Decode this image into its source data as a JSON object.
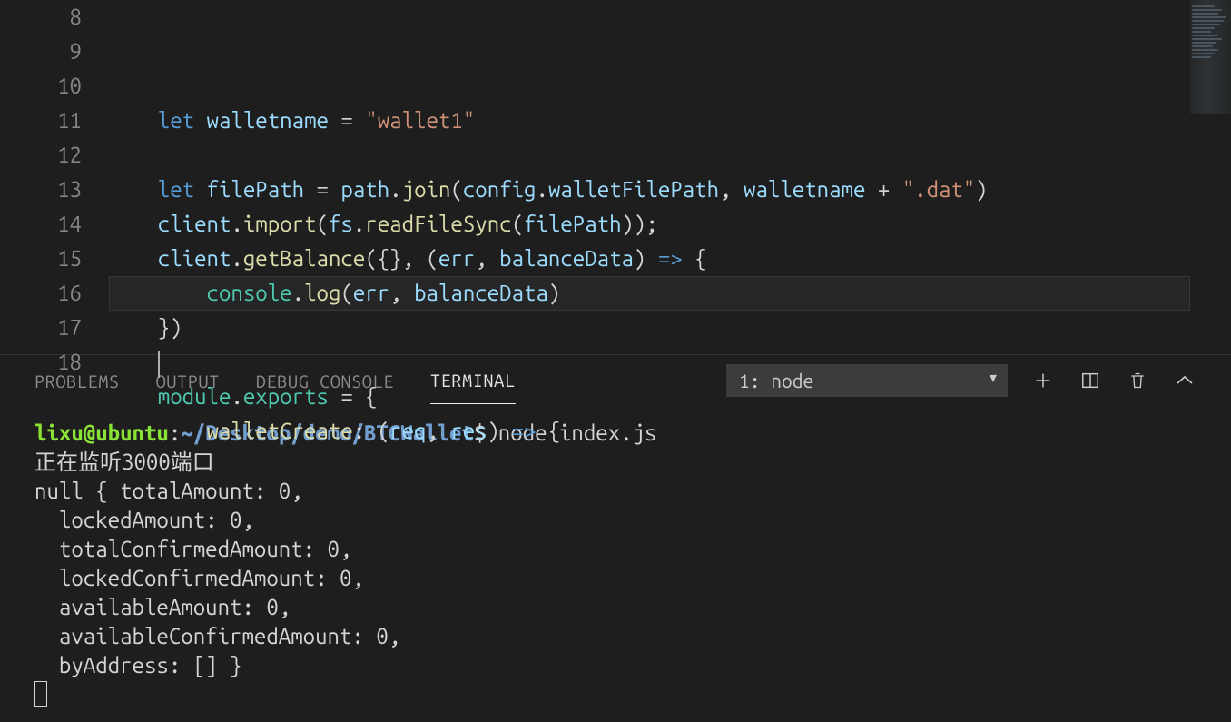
{
  "editor": {
    "line_numbers": [
      "8",
      "9",
      "10",
      "11",
      "12",
      "13",
      "14",
      "15",
      "16",
      "17",
      "18"
    ],
    "highlight_row_index": 8,
    "lines": [
      {
        "tokens": []
      },
      {
        "tokens": [
          {
            "t": "    ",
            "c": "punct"
          },
          {
            "t": "let",
            "c": "kw"
          },
          {
            "t": " ",
            "c": "punct"
          },
          {
            "t": "walletname",
            "c": "var"
          },
          {
            "t": " = ",
            "c": "punct"
          },
          {
            "t": "\"wallet1\"",
            "c": "str"
          }
        ]
      },
      {
        "tokens": []
      },
      {
        "tokens": [
          {
            "t": "    ",
            "c": "punct"
          },
          {
            "t": "let",
            "c": "kw"
          },
          {
            "t": " ",
            "c": "punct"
          },
          {
            "t": "filePath",
            "c": "var"
          },
          {
            "t": " = ",
            "c": "punct"
          },
          {
            "t": "path",
            "c": "var"
          },
          {
            "t": ".",
            "c": "punct"
          },
          {
            "t": "join",
            "c": "fn"
          },
          {
            "t": "(",
            "c": "punct"
          },
          {
            "t": "config",
            "c": "var"
          },
          {
            "t": ".",
            "c": "punct"
          },
          {
            "t": "walletFilePath",
            "c": "var"
          },
          {
            "t": ", ",
            "c": "punct"
          },
          {
            "t": "walletname",
            "c": "var"
          },
          {
            "t": " + ",
            "c": "punct"
          },
          {
            "t": "\".dat\"",
            "c": "str"
          },
          {
            "t": ")",
            "c": "punct"
          }
        ]
      },
      {
        "tokens": [
          {
            "t": "    ",
            "c": "punct"
          },
          {
            "t": "client",
            "c": "var"
          },
          {
            "t": ".",
            "c": "punct"
          },
          {
            "t": "import",
            "c": "fn"
          },
          {
            "t": "(",
            "c": "punct"
          },
          {
            "t": "fs",
            "c": "var"
          },
          {
            "t": ".",
            "c": "punct"
          },
          {
            "t": "readFileSync",
            "c": "fn"
          },
          {
            "t": "(",
            "c": "punct"
          },
          {
            "t": "filePath",
            "c": "var"
          },
          {
            "t": "));",
            "c": "punct"
          }
        ]
      },
      {
        "tokens": [
          {
            "t": "    ",
            "c": "punct"
          },
          {
            "t": "client",
            "c": "var"
          },
          {
            "t": ".",
            "c": "punct"
          },
          {
            "t": "getBalance",
            "c": "fn"
          },
          {
            "t": "({}, (",
            "c": "punct"
          },
          {
            "t": "err",
            "c": "var"
          },
          {
            "t": ", ",
            "c": "punct"
          },
          {
            "t": "balanceData",
            "c": "var"
          },
          {
            "t": ") ",
            "c": "punct"
          },
          {
            "t": "=>",
            "c": "kw"
          },
          {
            "t": " {",
            "c": "punct"
          }
        ]
      },
      {
        "tokens": [
          {
            "t": "        ",
            "c": "punct"
          },
          {
            "t": "console",
            "c": "obj"
          },
          {
            "t": ".",
            "c": "punct"
          },
          {
            "t": "log",
            "c": "fn"
          },
          {
            "t": "(",
            "c": "punct"
          },
          {
            "t": "err",
            "c": "var"
          },
          {
            "t": ", ",
            "c": "punct"
          },
          {
            "t": "balanceData",
            "c": "var"
          },
          {
            "t": ")",
            "c": "punct"
          }
        ]
      },
      {
        "tokens": [
          {
            "t": "    })",
            "c": "punct"
          }
        ]
      },
      {
        "tokens": [
          {
            "t": "    ",
            "c": "punct"
          }
        ],
        "cursor": true
      },
      {
        "tokens": [
          {
            "t": "    ",
            "c": "punct"
          },
          {
            "t": "module",
            "c": "obj"
          },
          {
            "t": ".",
            "c": "punct"
          },
          {
            "t": "exports",
            "c": "obj"
          },
          {
            "t": " = {",
            "c": "punct"
          }
        ]
      },
      {
        "tokens": [
          {
            "t": "        ",
            "c": "punct"
          },
          {
            "t": "walletCreate",
            "c": "fn"
          },
          {
            "t": ": (",
            "c": "punct"
          },
          {
            "t": "req",
            "c": "var"
          },
          {
            "t": ", ",
            "c": "punct"
          },
          {
            "t": "res",
            "c": "var"
          },
          {
            "t": ") ",
            "c": "punct"
          },
          {
            "t": "=>",
            "c": "kw"
          },
          {
            "t": " {",
            "c": "punct"
          }
        ]
      }
    ]
  },
  "panel": {
    "tabs": {
      "problems": "PROBLEMS",
      "output": "OUTPUT",
      "debug": "DEBUG CONSOLE",
      "terminal": "TERMINAL"
    },
    "dropdown_value": "1: node"
  },
  "terminal": {
    "user": "lixu@ubuntu",
    "colon": ":",
    "path": "~/Desktop/demo/BTCWallet",
    "dollar": "$ ",
    "command": "node index.js",
    "output_lines": [
      "正在监听3000端口",
      "null { totalAmount: 0,",
      "  lockedAmount: 0,",
      "  totalConfirmedAmount: 0,",
      "  lockedConfirmedAmount: 0,",
      "  availableAmount: 0,",
      "  availableConfirmedAmount: 0,",
      "  byAddress: [] }"
    ]
  }
}
